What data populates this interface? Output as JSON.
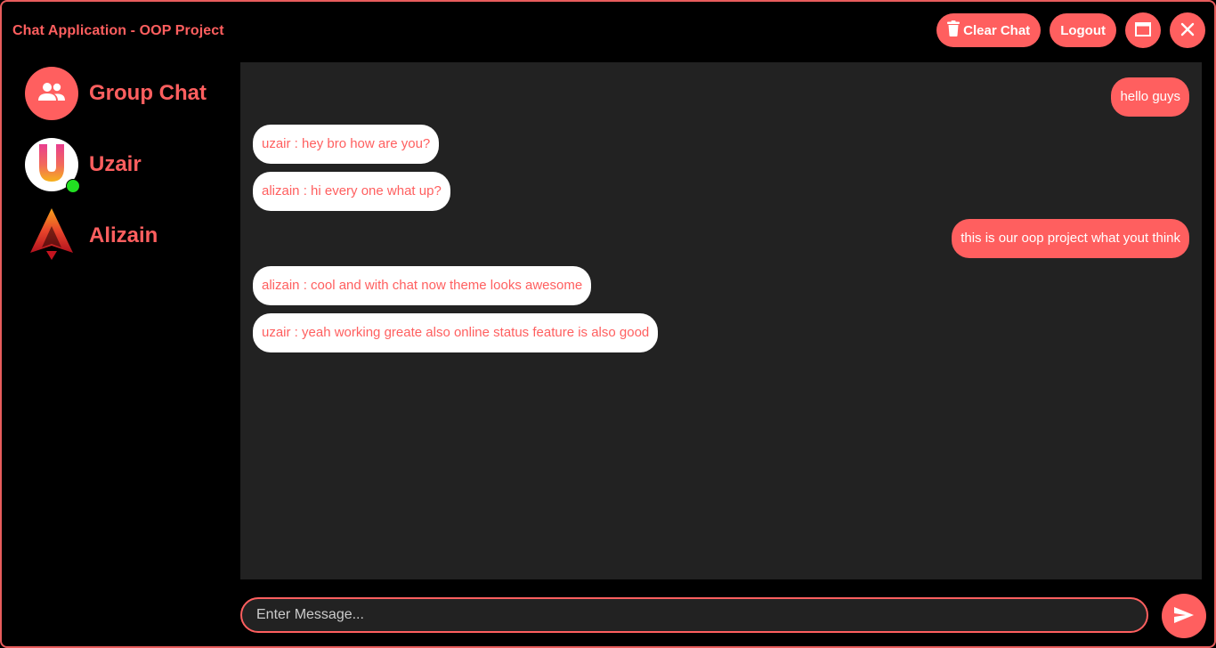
{
  "window": {
    "title": "Chat Application - OOP Project"
  },
  "toolbar": {
    "clear_label": "Clear Chat",
    "clear_icon": "trash-icon",
    "logout_label": "Logout",
    "maximize_icon": "maximize-icon",
    "close_icon": "close-icon"
  },
  "sidebar": {
    "items": [
      {
        "name": "Group Chat",
        "icon": "group-icon"
      },
      {
        "name": "Uzair",
        "icon": "letter-u-avatar",
        "online": true
      },
      {
        "name": "Alizain",
        "icon": "triangle-logo-avatar"
      }
    ]
  },
  "messages": [
    {
      "from": "me",
      "text": "hello guys"
    },
    {
      "from": "them",
      "text": "uzair : hey bro how are you?"
    },
    {
      "from": "them",
      "text": "alizain : hi every one what up?"
    },
    {
      "from": "me",
      "text": "this is our oop project what yout think"
    },
    {
      "from": "them",
      "text": "alizain : cool and with chat now theme looks awesome"
    },
    {
      "from": "them",
      "text": "uzair : yeah working greate also online status feature is also good"
    }
  ],
  "composer": {
    "placeholder": "Enter Message...",
    "value": "",
    "send_icon": "send-icon"
  },
  "colors": {
    "accent": "#ff5f5f",
    "background": "#000000",
    "panel": "#222222",
    "online": "#22e022"
  }
}
